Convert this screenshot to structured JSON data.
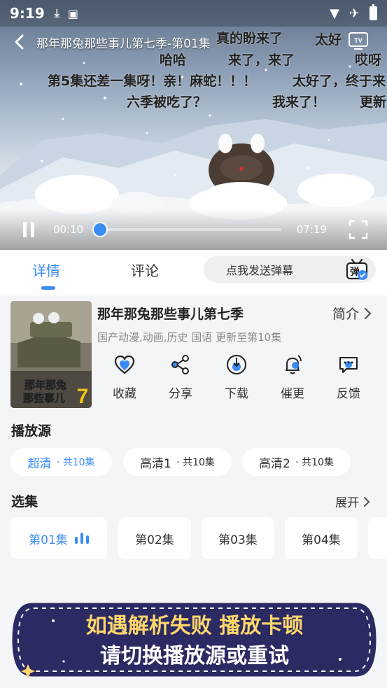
{
  "status_bar": {
    "time": "9:19"
  },
  "player": {
    "title": "那年那兔那些事儿第七季-第01集",
    "current_time": "00:10",
    "total_time": "07:19",
    "progress_fraction": 0.023,
    "danmaku": [
      {
        "text": "哈哈",
        "color": "#c0392b"
      },
      {
        "text": "来了，来了",
        "color": "#b0306a"
      },
      {
        "text": "第5集还差一集呀！亲！麻蛇！！！",
        "color": "#b02c7a"
      },
      {
        "text": "太好了，终于来",
        "color": "#b4281e"
      },
      {
        "text": "六季被吃了？",
        "color": "#1f49d1"
      },
      {
        "text": "我来了！",
        "color": "#b12a2a"
      },
      {
        "text": "真的盼来了",
        "color": "#1a7f2b"
      },
      {
        "text": "太好",
        "color": "#2b2b2b"
      },
      {
        "text": "哎呀",
        "color": "#1f49d1"
      },
      {
        "text": "更新",
        "color": "#1a7f2b"
      }
    ]
  },
  "tabs": {
    "details": "详情",
    "comments": "评论",
    "danmaku_placeholder": "点我发送弹幕"
  },
  "show": {
    "title": "那年那兔那些事儿第七季",
    "intro_label": "简介",
    "meta": "国产动漫,动画,历史 国语 更新至第10集",
    "poster_text": "那年那兔那些事儿7",
    "actions": [
      {
        "label": "收藏",
        "icon": "heart-icon"
      },
      {
        "label": "分享",
        "icon": "share-icon"
      },
      {
        "label": "下载",
        "icon": "download-icon"
      },
      {
        "label": "催更",
        "icon": "bell-icon"
      },
      {
        "label": "反馈",
        "icon": "feedback-icon"
      }
    ]
  },
  "sources": {
    "heading": "播放源",
    "items": [
      {
        "name": "超清",
        "count": "· 共10集"
      },
      {
        "name": "高清1",
        "count": "· 共10集"
      },
      {
        "name": "高清2",
        "count": "· 共10集"
      }
    ]
  },
  "episodes": {
    "heading": "选集",
    "expand_label": "展开",
    "items": [
      "第01集",
      "第02集",
      "第03集",
      "第04集"
    ]
  },
  "banner": {
    "line1": "如遇解析失败 播放卡顿",
    "line2": "请切换播放源或重试"
  },
  "colors": {
    "accent": "#3a8bf5",
    "banner_bg": "#2b2a63",
    "banner_text": "#ffd66b"
  }
}
